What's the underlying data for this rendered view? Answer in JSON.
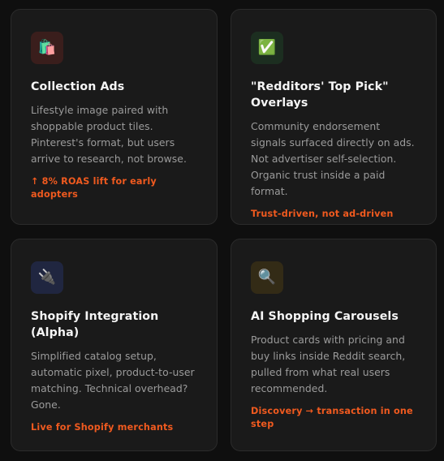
{
  "cards": [
    {
      "icon": "shopping-bag-icon",
      "icon_glyph": "🛍️",
      "title": "Collection Ads",
      "description": "Lifestyle image paired with shoppable product tiles. Pinterest's format, but users arrive to research, not browse.",
      "highlight": "↑ 8% ROAS lift for early adopters"
    },
    {
      "icon": "check-mark-icon",
      "icon_glyph": "✅",
      "title": "\"Redditors' Top Pick\" Overlays",
      "description": "Community endorsement signals surfaced directly on ads. Not advertiser self-selection. Organic trust inside a paid format.",
      "highlight": "Trust-driven, not ad-driven"
    },
    {
      "icon": "plug-icon",
      "icon_glyph": "🔌",
      "title": "Shopify Integration (Alpha)",
      "description": "Simplified catalog setup, automatic pixel, product-to-user matching. Technical overhead? Gone.",
      "highlight": "Live for Shopify merchants"
    },
    {
      "icon": "magnifying-glass-icon",
      "icon_glyph": "🔍",
      "title": "AI Shopping Carousels",
      "description": "Product cards with pricing and buy links inside Reddit search, pulled from what real users recommended.",
      "highlight": "Discovery → transaction in one step"
    }
  ],
  "colors": {
    "background": "#0f0f0f",
    "card": "#1a1a1a",
    "accent": "#f05a1f",
    "title": "#f5f5f5",
    "body": "#9b9b9b"
  }
}
